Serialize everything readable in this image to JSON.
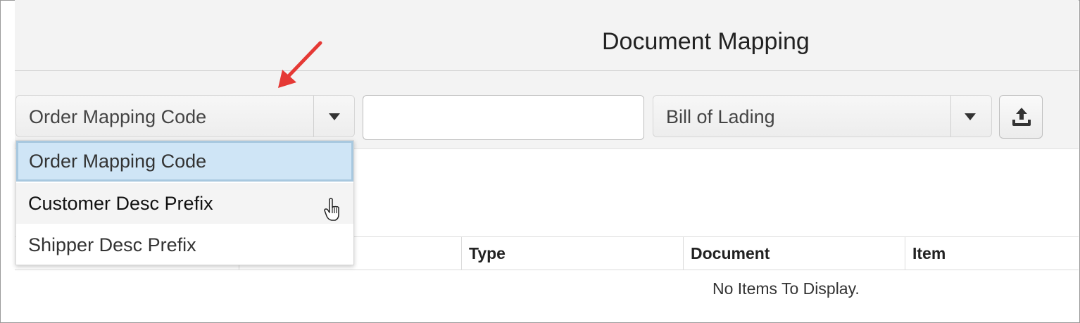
{
  "page": {
    "title": "Document Mapping"
  },
  "filters": {
    "field_select": {
      "value": "Order Mapping Code",
      "options": [
        "Order Mapping Code",
        "Customer Desc Prefix",
        "Shipper Desc Prefix"
      ],
      "selected_index": 0,
      "hover_index": 1
    },
    "search": {
      "value": "",
      "placeholder": ""
    },
    "document_type_select": {
      "value": "Bill of Lading"
    },
    "upload_icon": "upload-icon"
  },
  "table": {
    "columns": [
      "",
      "",
      "Type",
      "Document",
      "Item"
    ],
    "empty_message": "No Items To Display."
  },
  "colors": {
    "accent_selected": "#cfe5f6",
    "annotation_arrow": "#e53935"
  }
}
